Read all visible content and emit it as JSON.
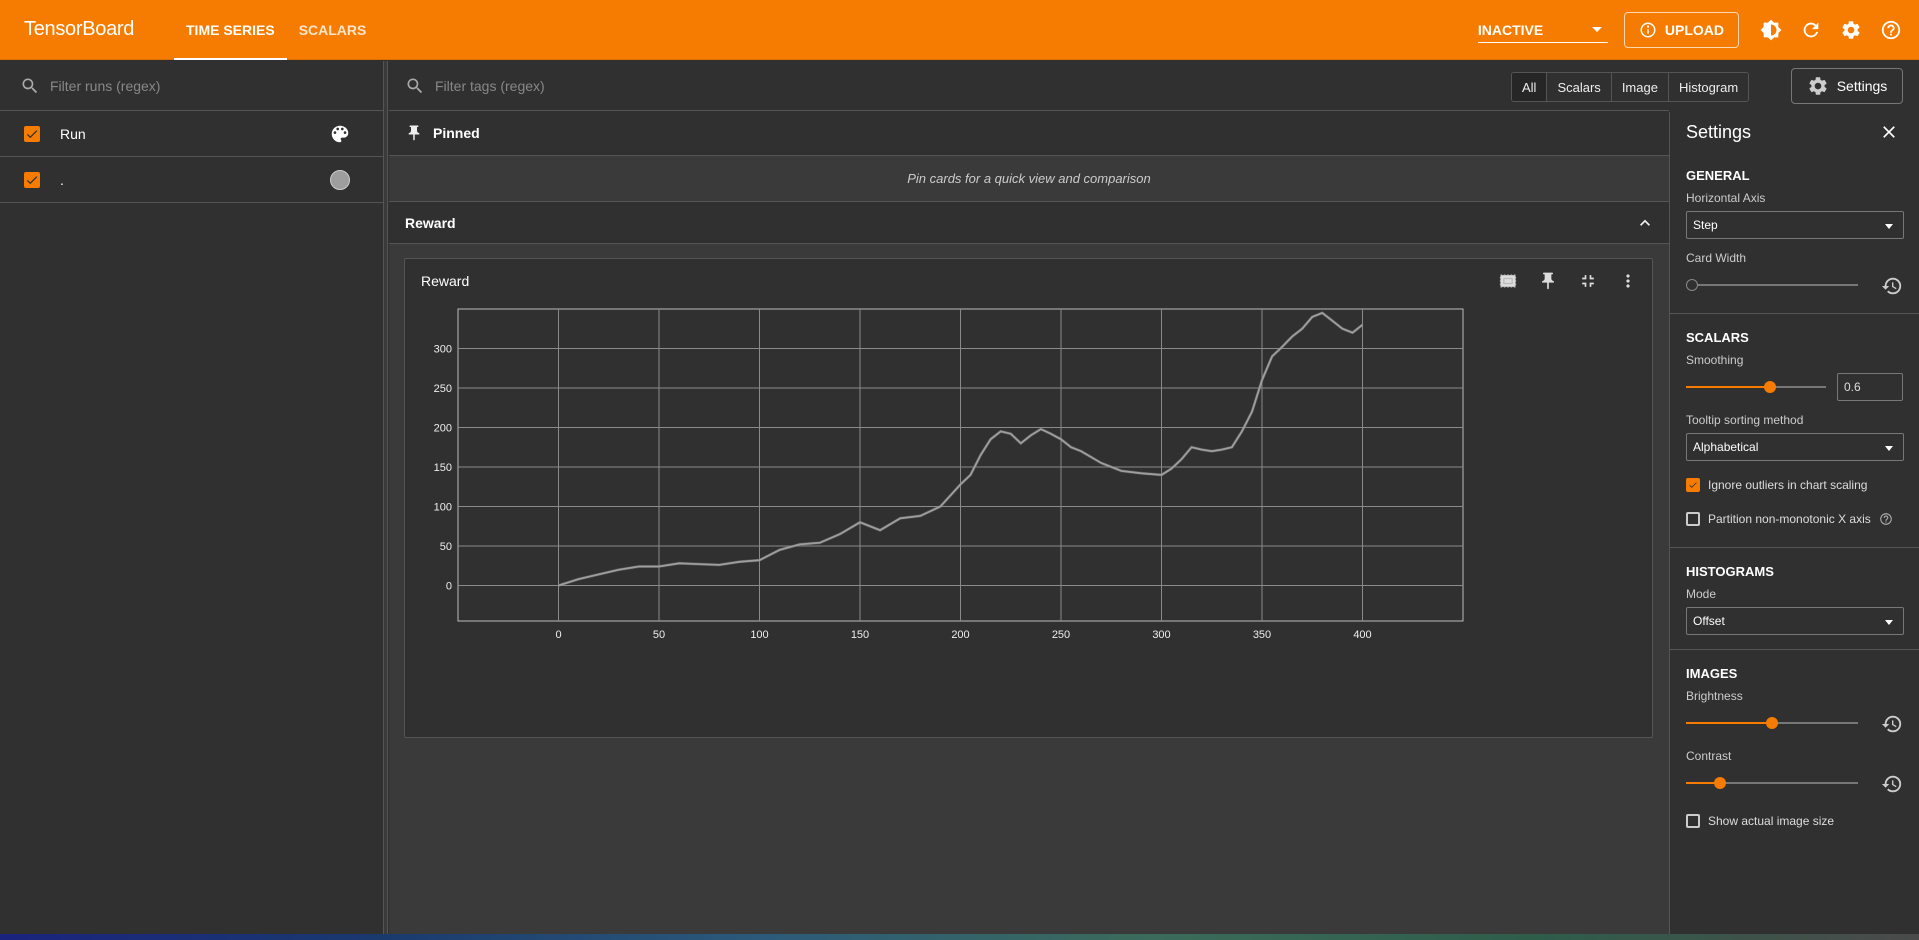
{
  "app": {
    "brand": "TensorBoard",
    "tabs": [
      {
        "label": "TIME SERIES",
        "active": true
      },
      {
        "label": "SCALARS",
        "active": false
      }
    ],
    "status_select": "INACTIVE",
    "upload_label": "UPLOAD",
    "accent_color": "#f57c00"
  },
  "sidebar": {
    "search_placeholder": "Filter runs (regex)",
    "header_label": "Run",
    "runs": [
      {
        "label": ".",
        "checked": true,
        "color": "#9e9e9e"
      }
    ]
  },
  "main": {
    "search_placeholder": "Filter tags (regex)",
    "type_filters": [
      "All",
      "Scalars",
      "Image",
      "Histogram"
    ],
    "settings_button": "Settings",
    "pinned_label": "Pinned",
    "pin_hint": "Pin cards for a quick view and comparison",
    "group_label": "Reward",
    "card_title": "Reward"
  },
  "chart_data": {
    "type": "line",
    "title": "Reward",
    "xlabel": "",
    "ylabel": "",
    "xticks": [
      0,
      50,
      100,
      150,
      200,
      250,
      300,
      350,
      400
    ],
    "yticks": [
      0,
      50,
      100,
      150,
      200,
      250,
      300
    ],
    "xlim": [
      -50,
      450
    ],
    "ylim": [
      -45,
      350
    ],
    "grid": true,
    "series": [
      {
        "color": "#9e9e9e",
        "x": [
          0,
          10,
          20,
          30,
          40,
          50,
          60,
          70,
          80,
          90,
          100,
          110,
          120,
          130,
          140,
          150,
          160,
          170,
          180,
          190,
          200,
          205,
          210,
          215,
          220,
          225,
          230,
          235,
          240,
          245,
          250,
          255,
          260,
          270,
          280,
          290,
          300,
          305,
          310,
          315,
          320,
          325,
          330,
          335,
          340,
          345,
          350,
          355,
          360,
          365,
          370,
          375,
          380,
          385,
          390,
          395,
          400
        ],
        "y": [
          0,
          8,
          14,
          20,
          24,
          24,
          28,
          27,
          26,
          30,
          32,
          45,
          52,
          54,
          65,
          80,
          70,
          85,
          88,
          100,
          128,
          140,
          165,
          185,
          195,
          192,
          180,
          190,
          198,
          192,
          185,
          175,
          170,
          155,
          145,
          142,
          140,
          148,
          160,
          175,
          172,
          170,
          172,
          175,
          195,
          220,
          260,
          290,
          302,
          315,
          325,
          340,
          345,
          335,
          325,
          320,
          330
        ]
      }
    ]
  },
  "settings": {
    "title": "Settings",
    "general": {
      "heading": "GENERAL",
      "horizontal_axis_label": "Horizontal Axis",
      "horizontal_axis_value": "Step",
      "card_width_label": "Card Width",
      "card_width_level": 0
    },
    "scalars": {
      "heading": "SCALARS",
      "smoothing_label": "Smoothing",
      "smoothing_value": "0.6",
      "smoothing_level": 0.6,
      "tooltip_label": "Tooltip sorting method",
      "tooltip_value": "Alphabetical",
      "ignore_outliers_label": "Ignore outliers in chart scaling",
      "ignore_outliers": true,
      "partition_label": "Partition non-monotonic X axis",
      "partition": false
    },
    "histograms": {
      "heading": "HISTOGRAMS",
      "mode_label": "Mode",
      "mode_value": "Offset"
    },
    "images": {
      "heading": "IMAGES",
      "brightness_label": "Brightness",
      "brightness_level": 0.5,
      "contrast_label": "Contrast",
      "contrast_level": 0.2,
      "actual_size_label": "Show actual image size",
      "actual_size": false
    }
  }
}
